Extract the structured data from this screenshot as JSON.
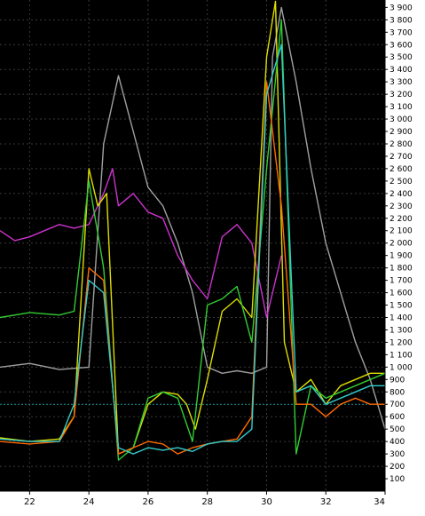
{
  "chart_data": {
    "type": "line",
    "title": "",
    "xlabel": "",
    "ylabel": "",
    "xlim": [
      21.0,
      34.0
    ],
    "ylim": [
      0,
      3960
    ],
    "x_ticks": [
      "22",
      "24",
      "26",
      "28",
      "30",
      "32",
      "34"
    ],
    "x_tick_values": [
      22,
      24,
      26,
      28,
      30,
      32,
      34
    ],
    "y_ticks": [
      "100",
      "200",
      "300",
      "400",
      "500",
      "600",
      "700",
      "800",
      "900",
      "1 000",
      "1 100",
      "1 200",
      "1 300",
      "1 400",
      "1 500",
      "1 600",
      "1 700",
      "1 800",
      "1 900",
      "2 000",
      "2 100",
      "2 200",
      "2 300",
      "2 400",
      "2 500",
      "2 600",
      "2 700",
      "2 800",
      "2 900",
      "3 000",
      "3 100",
      "3 200",
      "3 300",
      "3 400",
      "3 500",
      "3 600",
      "3 700",
      "3 800",
      "3 900"
    ],
    "y_tick_values": [
      100,
      200,
      300,
      400,
      500,
      600,
      700,
      800,
      900,
      1000,
      1100,
      1200,
      1300,
      1400,
      1500,
      1600,
      1700,
      1800,
      1900,
      2000,
      2100,
      2200,
      2300,
      2400,
      2500,
      2600,
      2700,
      2800,
      2900,
      3000,
      3100,
      3200,
      3300,
      3400,
      3500,
      3600,
      3700,
      3800,
      3900
    ],
    "reference_line": {
      "y": 700,
      "style": "dotted",
      "color": "#1a9aa0"
    },
    "grid": true,
    "background": "#000000",
    "series": [
      {
        "color": "#a0a0a0",
        "x": [
          21,
          22,
          23,
          24,
          24.5,
          25,
          25.5,
          26,
          26.5,
          27,
          27.5,
          28,
          28.5,
          29,
          29.5,
          30,
          30.2,
          30.5,
          31,
          31.5,
          32,
          32.5,
          33,
          33.5,
          34
        ],
        "y": [
          1000,
          1030,
          980,
          1000,
          2800,
          3350,
          2900,
          2450,
          2300,
          2000,
          1600,
          1000,
          950,
          970,
          950,
          1000,
          3500,
          3900,
          3300,
          2600,
          2000,
          1600,
          1200,
          900,
          500
        ]
      },
      {
        "color": "#cc33cc",
        "x": [
          21,
          21.5,
          22,
          22.5,
          23,
          23.5,
          24,
          24.5,
          24.8,
          25,
          25.5,
          26,
          26.5,
          27,
          27.5,
          28,
          28.5,
          29,
          29.5,
          30,
          30.5
        ],
        "y": [
          2100,
          2020,
          2050,
          2100,
          2150,
          2120,
          2150,
          2400,
          2600,
          2300,
          2400,
          2250,
          2200,
          1900,
          1700,
          1550,
          2050,
          2150,
          2000,
          1400,
          1900
        ]
      },
      {
        "color": "#dddd00",
        "x": [
          21,
          22,
          23,
          23.5,
          24,
          24.3,
          24.6,
          25,
          25.5,
          26,
          26.5,
          27,
          27.3,
          27.6,
          28,
          28.5,
          29,
          29.5,
          30,
          30.3,
          30.6,
          31,
          31.5,
          32,
          32.5,
          33,
          33.5,
          34
        ],
        "y": [
          430,
          400,
          420,
          600,
          2600,
          2300,
          2400,
          300,
          350,
          700,
          800,
          780,
          700,
          500,
          900,
          1450,
          1550,
          1400,
          3500,
          3950,
          1200,
          800,
          900,
          700,
          850,
          900,
          950,
          950
        ]
      },
      {
        "color": "#33cc33",
        "x": [
          21,
          22,
          23,
          23.5,
          24,
          24.5,
          25,
          25.5,
          26,
          26.5,
          27,
          27.5,
          28,
          28.5,
          29,
          29.5,
          30,
          30.5,
          31,
          31.5,
          32,
          32.5,
          33,
          33.5,
          34
        ],
        "y": [
          1400,
          1440,
          1420,
          1450,
          2500,
          1800,
          250,
          350,
          750,
          800,
          750,
          400,
          1500,
          1550,
          1650,
          1200,
          2600,
          3800,
          300,
          850,
          750,
          800,
          850,
          900,
          950
        ]
      },
      {
        "color": "#ff6a00",
        "x": [
          21,
          22,
          23,
          23.5,
          24,
          24.5,
          25,
          25.5,
          26,
          26.5,
          27,
          27.5,
          28,
          28.5,
          29,
          29.5,
          30,
          30.5,
          31,
          31.5,
          32,
          32.5,
          33,
          33.5,
          34
        ],
        "y": [
          400,
          380,
          400,
          600,
          1800,
          1700,
          300,
          350,
          400,
          380,
          300,
          350,
          380,
          400,
          420,
          600,
          3300,
          2300,
          700,
          700,
          600,
          700,
          750,
          700,
          700
        ]
      },
      {
        "color": "#33cccc",
        "x": [
          21,
          22,
          23,
          23.5,
          24,
          24.5,
          25,
          25.5,
          26,
          26.5,
          27,
          27.5,
          28,
          28.5,
          29,
          29.5,
          30,
          30.5,
          31,
          31.5,
          32,
          32.5,
          33,
          33.5,
          34
        ],
        "y": [
          420,
          400,
          400,
          700,
          1700,
          1600,
          350,
          300,
          350,
          330,
          350,
          320,
          380,
          400,
          400,
          500,
          3200,
          3600,
          800,
          850,
          700,
          750,
          800,
          850,
          850
        ]
      }
    ]
  }
}
